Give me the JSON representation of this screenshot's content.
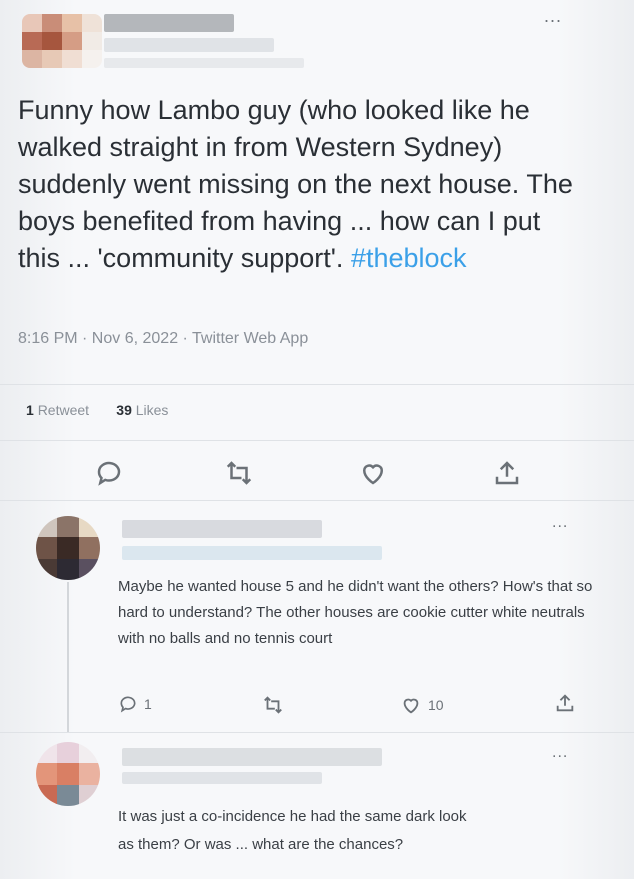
{
  "main_tweet": {
    "more": "...",
    "text": "Funny how Lambo guy (who looked like he walked straight in from Western Sydney) suddenly went missing on the next house. The boys benefited from having ... how can I put this ... 'community support'. ",
    "hashtag": "#theblock",
    "meta": "8:16 PM · Nov 6, 2022 · Twitter Web App",
    "retweets_count": "1",
    "retweets_label": "Retweet",
    "likes_count": "39",
    "likes_label": "Likes"
  },
  "reply1": {
    "more": "...",
    "text": "Maybe he wanted house 5 and he didn't want the others? How's that so hard to understand? The other houses are cookie cutter white neutrals with no balls and no tennis court",
    "reply_count": "1",
    "like_count": "10"
  },
  "reply2": {
    "more": "...",
    "text_line1": "It was just a co-incidence he had the same dark look",
    "text_line2": "as them? Or was ... what are the chances?"
  },
  "icons": {
    "reply": "reply-icon",
    "retweet": "retweet-icon",
    "like": "heart-icon",
    "share": "share-icon"
  }
}
